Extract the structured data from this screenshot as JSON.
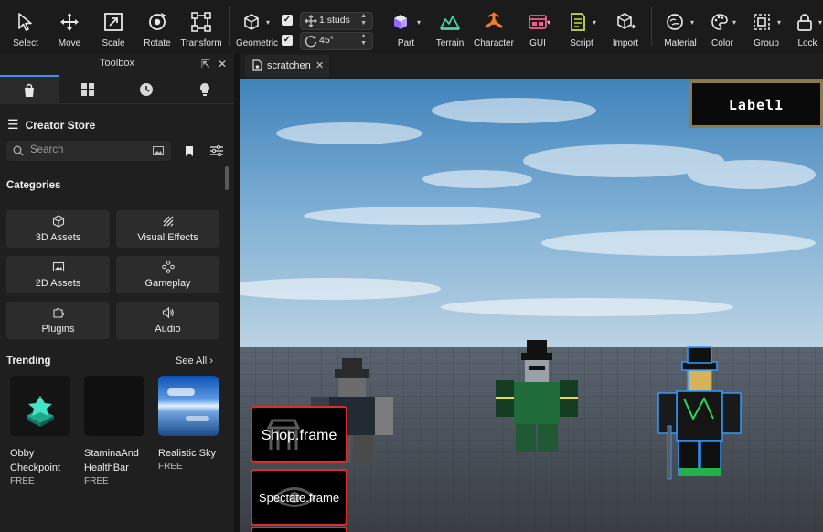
{
  "ribbon": {
    "tools": [
      {
        "label": "Select",
        "icon": "cursor-icon"
      },
      {
        "label": "Move",
        "icon": "move-arrows-icon"
      },
      {
        "label": "Scale",
        "icon": "scale-icon"
      },
      {
        "label": "Rotate",
        "icon": "rotate-icon"
      },
      {
        "label": "Transform",
        "icon": "transform-icon"
      }
    ],
    "geometric_label": "Geometric",
    "move_snap_value": "1 studs",
    "rotate_snap_value": "45°",
    "insert": [
      {
        "label": "Part",
        "icon": "part-cube-icon"
      },
      {
        "label": "Terrain",
        "icon": "terrain-icon"
      },
      {
        "label": "Character",
        "icon": "character-icon"
      },
      {
        "label": "GUI",
        "icon": "gui-icon"
      },
      {
        "label": "Script",
        "icon": "script-icon"
      },
      {
        "label": "Import",
        "icon": "import-icon"
      }
    ],
    "format": [
      {
        "label": "Material",
        "icon": "material-icon"
      },
      {
        "label": "Color",
        "icon": "palette-icon"
      },
      {
        "label": "Group",
        "icon": "group-icon"
      },
      {
        "label": "Lock",
        "icon": "lock-icon"
      }
    ]
  },
  "toolbox": {
    "title": "Toolbox",
    "store_title": "Creator Store",
    "search_placeholder": "Search",
    "categories_heading": "Categories",
    "categories": [
      {
        "label": "3D Assets",
        "icon": "cube-outline-icon"
      },
      {
        "label": "Visual Effects",
        "icon": "effects-icon"
      },
      {
        "label": "2D Assets",
        "icon": "image-icon"
      },
      {
        "label": "Gameplay",
        "icon": "gameplay-icon"
      },
      {
        "label": "Plugins",
        "icon": "puzzle-icon"
      },
      {
        "label": "Audio",
        "icon": "speaker-icon"
      }
    ],
    "trending_heading": "Trending",
    "see_all": "See All",
    "assets": [
      {
        "name_line1": "Obby",
        "name_line2": "Checkpoint",
        "price": "FREE"
      },
      {
        "name_line1": "StaminaAnd",
        "name_line2": "HealthBar",
        "price": "FREE"
      },
      {
        "name_line1": "Realistic Sky",
        "name_line2": "",
        "price": "FREE"
      }
    ]
  },
  "document_tab": "scratchen",
  "viewport": {
    "label_text": "Label1",
    "frames": [
      "Shop.frame",
      "Spectate.frame"
    ]
  },
  "colors": {
    "accent": "#3c8ef5",
    "frame_border": "#e12a2a",
    "selection": "#2f9bff"
  }
}
